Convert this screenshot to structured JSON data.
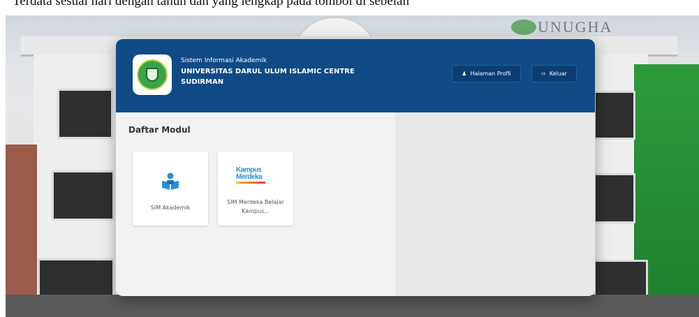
{
  "page": {
    "top_text": "Terdata sesuai hari dengan tahun dan yang lengkap pada tombol di sebelah"
  },
  "background": {
    "sign_text": "UNUGHA"
  },
  "header": {
    "subtitle": "Sistem Informasi Akademik",
    "title": "UNIVERSITAS DARUL ULUM ISLAMIC CENTRE SUDIRMAN",
    "buttons": {
      "profile_label": "Halaman Profil",
      "profile_icon": "user-icon",
      "logout_label": "Keluar",
      "logout_icon": "logout-icon"
    },
    "colors": {
      "header_bg": "#0f4a87",
      "button_bg": "#0a3e73"
    }
  },
  "modules": {
    "title": "Daftar Modul",
    "items": [
      {
        "label": "SIM Akademik",
        "icon": "reading-person-icon"
      },
      {
        "label": "SIM Merdeka Belajar Kampus...",
        "icon": "kampus-merdeka-logo",
        "logo_line1": "Kampus",
        "logo_line2": "Merdeka"
      }
    ]
  }
}
